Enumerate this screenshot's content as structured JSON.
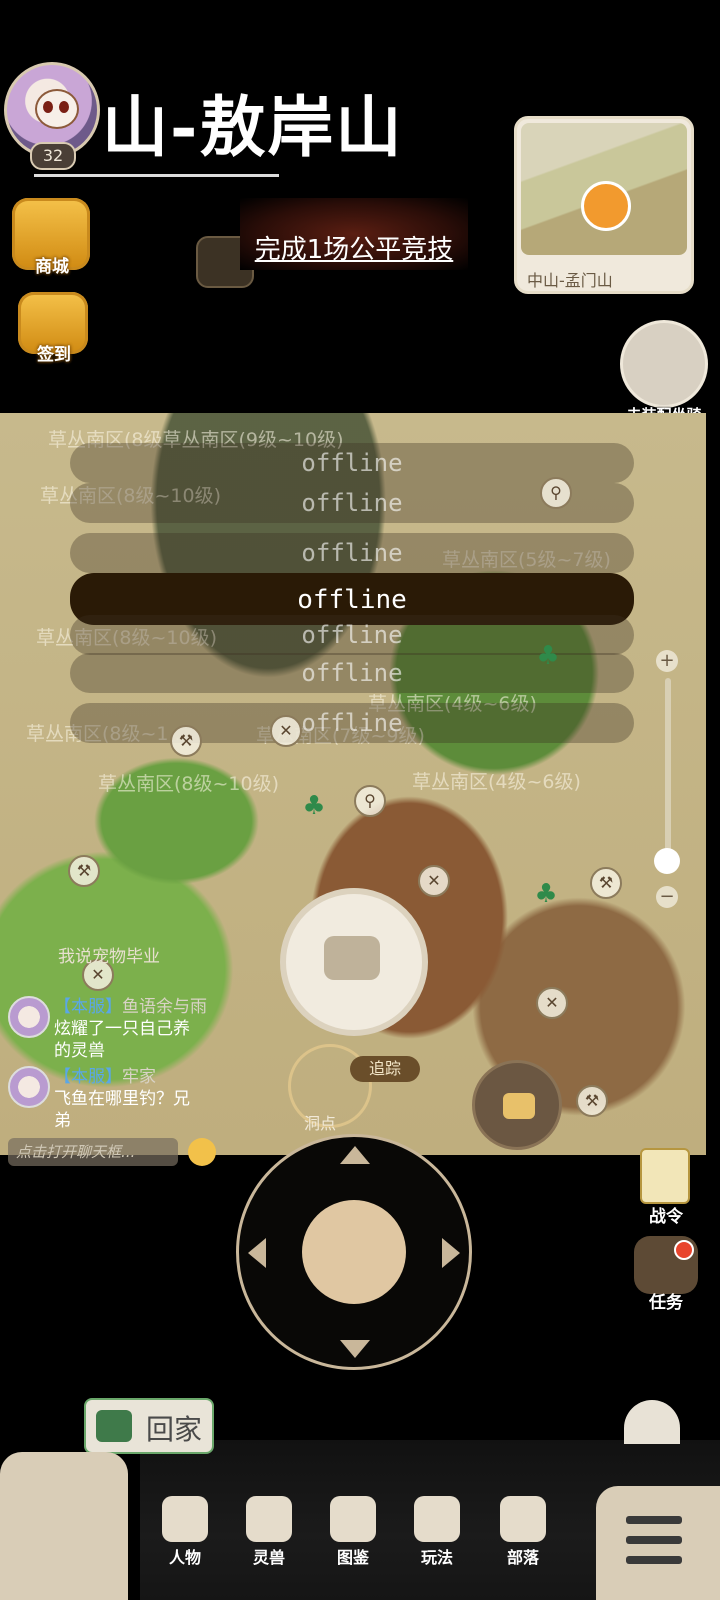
{
  "player": {
    "level": "32"
  },
  "location": {
    "title": "山-敖岸山"
  },
  "side_buttons": {
    "shop": "商城",
    "checkin": "签到"
  },
  "quest": {
    "text": "完成1场公平竞技"
  },
  "minimap": {
    "label": "中山-孟门山"
  },
  "mount": {
    "label": "未装配坐骑"
  },
  "map": {
    "zone_labels": [
      "草丛南区(8级草丛南区(9级~10级)",
      "草丛南区(8级~10级)",
      "草丛南区(5级~7级)",
      "草丛南区(8级~10级)",
      "草丛南区(4级~6级)",
      "草丛南区(8级~1...",
      "草丛南区(7级~9级)",
      "草丛南区(8级~10级)",
      "草丛南区(4级~6级)"
    ],
    "offline_rows": [
      "offline",
      "offline",
      "offline",
      "offline",
      "offline",
      "offline",
      "offline"
    ],
    "offline_main": "offline",
    "track_label": "追踪",
    "cave_label": "洞点"
  },
  "chat": {
    "partial": "我说宠物毕业",
    "messages": [
      {
        "tag": "【本服】",
        "name": "鱼语余与雨",
        "text1": "炫耀了一只自己养",
        "text2": "的灵兽"
      },
      {
        "tag": "【本服】",
        "name": "牢家",
        "text1": "飞鱼在哪里钓？兄",
        "text2": "弟"
      }
    ],
    "input_placeholder": "点击打开聊天框..."
  },
  "right_buttons": {
    "pass": "战令",
    "task": "任务"
  },
  "home": {
    "label": "回家"
  },
  "nav": {
    "items": [
      "人物",
      "灵兽",
      "图鉴",
      "玩法",
      "部落"
    ]
  }
}
